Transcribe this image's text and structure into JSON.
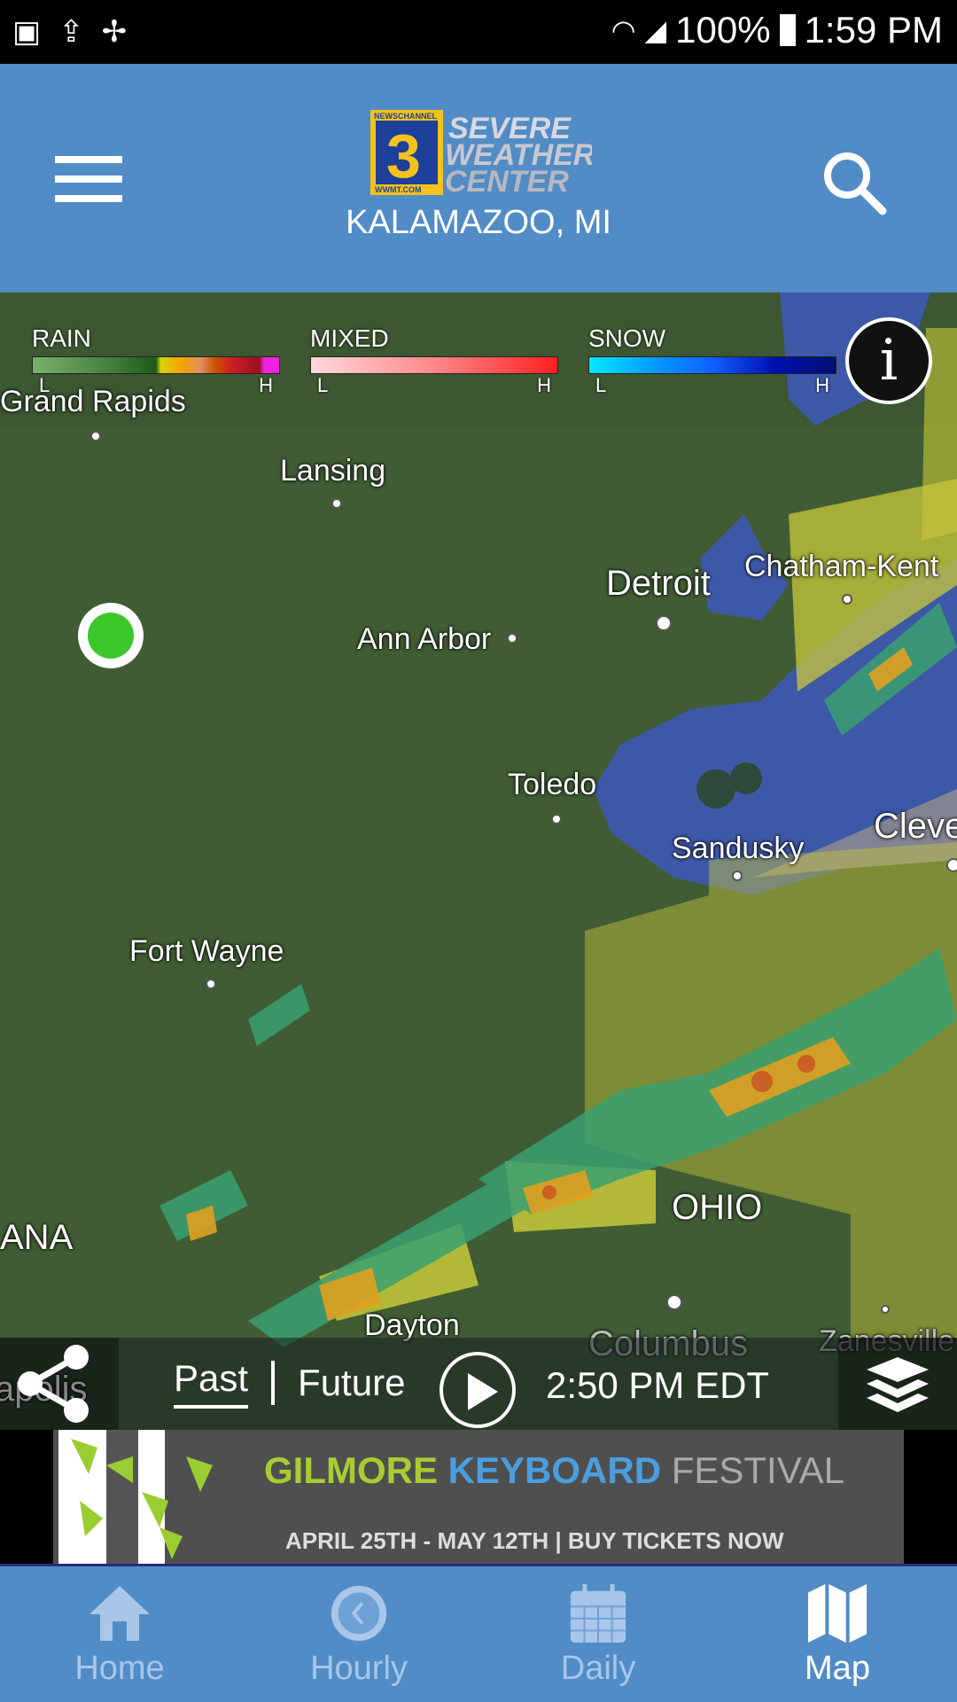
{
  "status_bar": {
    "battery": "100%",
    "time": "1:59 PM",
    "icons": [
      "image-icon",
      "upload-icon",
      "pinwheel-icon",
      "wifi-icon",
      "signal-icon",
      "battery-icon"
    ]
  },
  "header": {
    "logo_text": "NEWSCHANNEL 3 SEVERE WEATHER CENTER WWMT.COM",
    "location": "KALAMAZOO, MI"
  },
  "legend": [
    {
      "label": "RAIN",
      "low": "L",
      "high": "H",
      "colors": [
        "#78b26a",
        "#5f9a55",
        "#47823f",
        "#2f6a2a",
        "#1e5a1c",
        "#d6d600",
        "#f2a400",
        "#e09060",
        "#c85400",
        "#d02020",
        "#b01818",
        "#981020",
        "#f020e0"
      ]
    },
    {
      "label": "MIXED",
      "low": "L",
      "high": "H",
      "colors": [
        "#ffd8dc",
        "#ffb0b4",
        "#ff8888",
        "#ff5050",
        "#ff2020"
      ]
    },
    {
      "label": "SNOW",
      "low": "L",
      "high": "H",
      "colors": [
        "#00e8ff",
        "#00a0ff",
        "#1060ff",
        "#0030e0",
        "#0010b0",
        "#001070"
      ]
    }
  ],
  "map": {
    "places": [
      "Grand Rapids",
      "Lansing",
      "Detroit",
      "Chatham-Kent",
      "Ann Arbor",
      "Toledo",
      "Sandusky",
      "Cleve",
      "Fort Wayne",
      "OHIO",
      "ANA",
      "Dayton",
      "Columbus",
      "Zanesville",
      "apolis"
    ],
    "location_marker_color": "#3bc72a"
  },
  "controls": {
    "past": "Past",
    "future": "Future",
    "time": "2:50 PM EDT"
  },
  "ad": {
    "word1": "GILMORE",
    "word2": "KEYBOARD",
    "word3": "FESTIVAL",
    "line2": "APRIL 25TH - MAY 12TH | BUY TICKETS NOW"
  },
  "nav": [
    {
      "label": "Home"
    },
    {
      "label": "Hourly"
    },
    {
      "label": "Daily"
    },
    {
      "label": "Map"
    }
  ],
  "colors": {
    "header": "#518cc6",
    "active_nav": "#ffffff",
    "inactive_nav": "#a7c6ea"
  }
}
